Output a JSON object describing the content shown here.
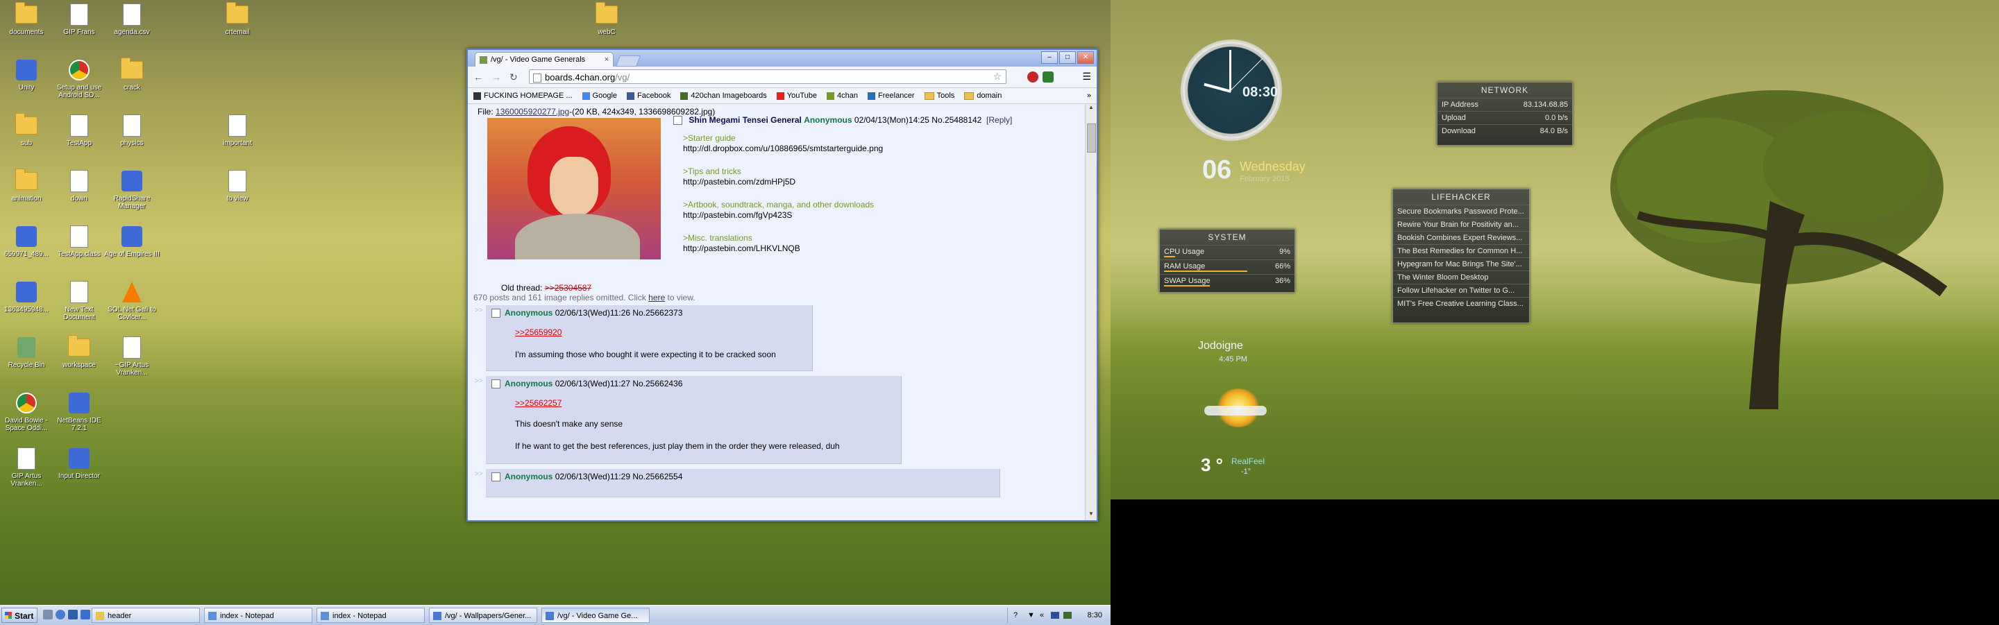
{
  "desktop_icons": [
    {
      "label": "documents",
      "icon": "folder"
    },
    {
      "label": "GIP Frans",
      "icon": "doc"
    },
    {
      "label": "agenda.csv",
      "icon": "doc"
    },
    {
      "label": "crtemail",
      "icon": "folder"
    },
    {
      "label": "Unity",
      "icon": "exe"
    },
    {
      "label": "Setup and use Android SD...",
      "icon": "chrome"
    },
    {
      "label": "crack",
      "icon": "folder"
    },
    {
      "label": "sub",
      "icon": "folder"
    },
    {
      "label": "TestApp",
      "icon": "doc"
    },
    {
      "label": "physics",
      "icon": "doc"
    },
    {
      "label": "important",
      "icon": "doc"
    },
    {
      "label": "animation",
      "icon": "folder"
    },
    {
      "label": "down",
      "icon": "doc"
    },
    {
      "label": "RapidShare Manager",
      "icon": "exe"
    },
    {
      "label": "to view",
      "icon": "doc"
    },
    {
      "label": "659971_489...",
      "icon": "exe"
    },
    {
      "label": "TestApp.class",
      "icon": "doc"
    },
    {
      "label": "Age of Empires III",
      "icon": "exe"
    },
    {
      "label": "1363495948...",
      "icon": "exe"
    },
    {
      "label": "New Text Document",
      "icon": "doc"
    },
    {
      "label": "SOL Net Gali to Csvlcer...",
      "icon": "vlc"
    },
    {
      "label": "Recycle Bin",
      "icon": "recycle"
    },
    {
      "label": "workspace",
      "icon": "folder"
    },
    {
      "label": "~GIP Artus Vranken...",
      "icon": "doc"
    },
    {
      "label": "David Bowie - Space Oddi...",
      "icon": "chrome"
    },
    {
      "label": "NetBeans IDE 7.2.1",
      "icon": "exe"
    },
    {
      "label": "GIP Artus Vranken...",
      "icon": "doc"
    },
    {
      "label": "Input Director",
      "icon": "exe"
    },
    {
      "label": "webC",
      "icon": "folder"
    }
  ],
  "browser": {
    "tab_title": "/vg/ - Video Game Generals",
    "url_host": "boards.4chan.org",
    "url_path": "/vg/",
    "bookmarks": [
      "FUCKING HOMEPAGE ...",
      "Google",
      "Facebook",
      "420chan Imageboards",
      "YouTube",
      "4chan",
      "Freelancer",
      "Tools",
      "domain"
    ],
    "window_buttons": {
      "minimize": "–",
      "maximize": "□",
      "close": "✕"
    }
  },
  "thread": {
    "file_label": "File: ",
    "file_name": "1360005920277.jpg",
    "file_meta": "-(20 KB, 424x349, 1336698609282.jpg)",
    "subject": "Shin Megami Tensei General",
    "name": "Anonymous",
    "datetime": "02/04/13(Mon)14:25 No.25488142",
    "reply_link": "[Reply]",
    "lines": [
      {
        "green": ">Starter guide",
        "url": "http://dl.dropbox.com/u/10886965/smtstarterguide.png"
      },
      {
        "green": ">Tips and tricks",
        "url": "http://pastebin.com/zdmHPj5D"
      },
      {
        "green": ">Artbook, soundtrack, manga, and other downloads",
        "url": "http://pastebin.com/fgVp423S"
      },
      {
        "green": ">Misc. translations",
        "url": "http://pastebin.com/LHKVLNQB"
      }
    ],
    "old_thread_label": "Old thread: ",
    "old_thread_link": ">>25304587",
    "omitted_text": "670 posts and 161 image replies omitted. Click ",
    "omitted_link": "here",
    "omitted_tail": " to view."
  },
  "replies": [
    {
      "name": "Anonymous",
      "datetime": "02/06/13(Wed)11:26 No.25662373",
      "quote": ">>25659920",
      "text1": "I'm assuming those who bought it were expecting it to be cracked soon",
      "text2": ""
    },
    {
      "name": "Anonymous",
      "datetime": "02/06/13(Wed)11:27 No.25662436",
      "quote": ">>25662257",
      "text1": "This doesn't make any sense",
      "text2": "If he want to get the best references, just play them in the order they were released, duh"
    },
    {
      "name": "Anonymous",
      "datetime": "02/06/13(Wed)11:29 No.25662554",
      "quote": "",
      "text1": "",
      "text2": ""
    }
  ],
  "taskbar": {
    "start_label": "Start",
    "buttons": [
      {
        "label": "header",
        "active": false
      },
      {
        "label": "index - Notepad",
        "active": false
      },
      {
        "label": "index - Notepad",
        "active": false
      },
      {
        "label": "/vg/ - Wallpapers/Gener...",
        "active": false
      },
      {
        "label": "/vg/ - Video Game Ge...",
        "active": true
      }
    ],
    "clock": "8:30"
  },
  "gadgets": {
    "clock": {
      "time": "08:30",
      "day_num": "06",
      "weekday": "Wednesday",
      "date": "February 2013"
    },
    "network": {
      "title": "NETWORK",
      "rows": [
        {
          "label": "IP Address",
          "value": "83.134.68.85"
        },
        {
          "label": "Upload",
          "value": "0.0 b/s"
        },
        {
          "label": "Download",
          "value": "84.0 B/s"
        }
      ]
    },
    "system": {
      "title": "SYSTEM",
      "rows": [
        {
          "label": "CPU Usage",
          "value": "9%",
          "level": 0.09
        },
        {
          "label": "RAM Usage",
          "value": "66%",
          "level": 0.66
        },
        {
          "label": "SWAP Usage",
          "value": "36%",
          "level": 0.36
        }
      ]
    },
    "lifehacker": {
      "title": "LIFEHACKER",
      "items": [
        "Secure Bookmarks Password Prote...",
        "Rewire Your Brain for Positivity an...",
        "Bookish Combines Expert Reviews...",
        "The Best Remedies for Common H...",
        "Hypegram for Mac Brings The Site'...",
        "The Winter Bloom Desktop",
        "Follow Lifehacker on Twitter to G...",
        "MIT's Free Creative Learning Class..."
      ]
    },
    "weather": {
      "city": "Jodoigne",
      "time": "4:45 PM",
      "temp": "3 °",
      "realfeel_label": "RealFeel",
      "realfeel_value": "-1°"
    }
  }
}
